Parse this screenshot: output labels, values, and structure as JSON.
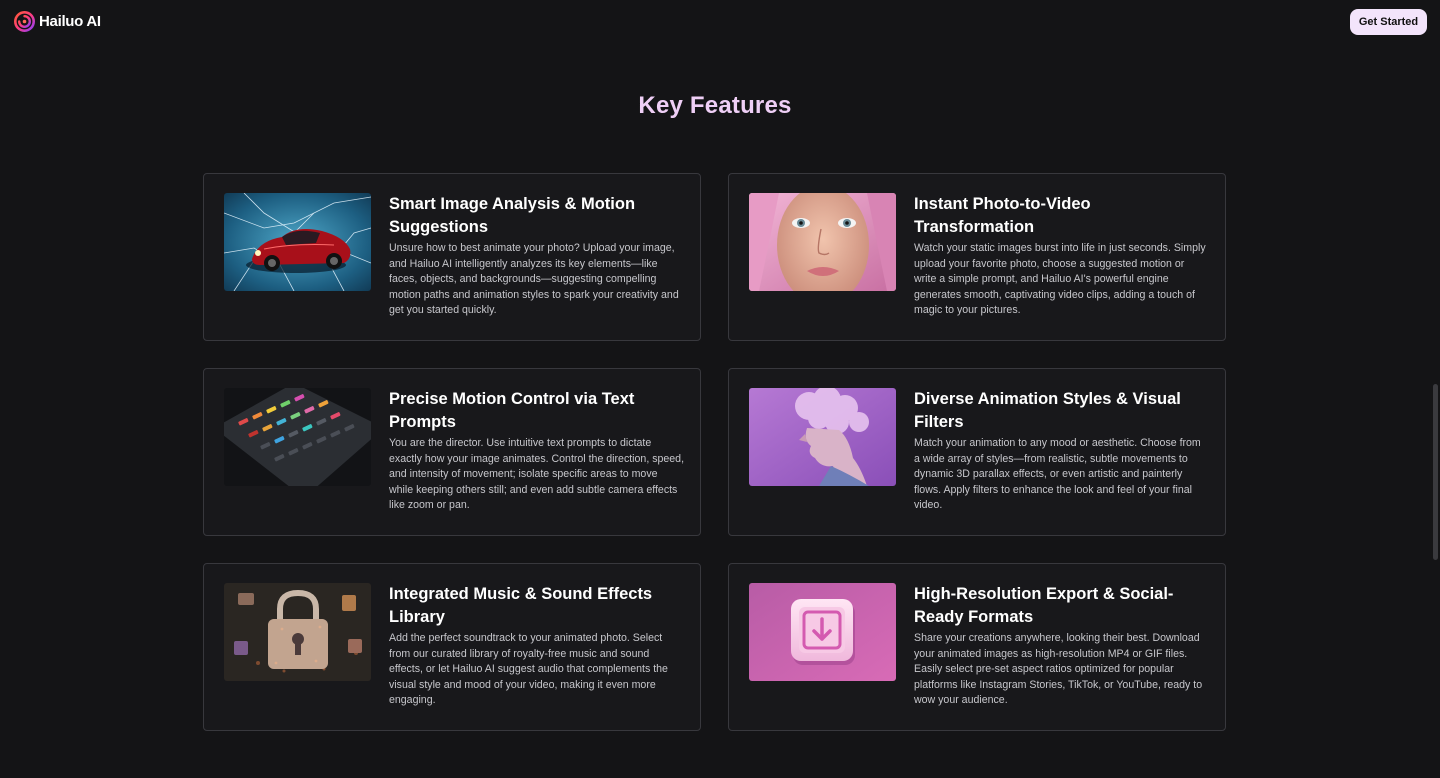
{
  "header": {
    "logo_text": "Hailuo AI",
    "cta_label": "Get Started"
  },
  "section": {
    "title": "Key Features"
  },
  "features": [
    {
      "title": "Smart Image Analysis & Motion Suggestions",
      "description": "Unsure how to best animate your photo? Upload your image, and Hailuo AI intelligently analyzes its key elements—like faces, objects, and backgrounds—suggesting compelling motion paths and animation styles to spark your creativity and get you started quickly."
    },
    {
      "title": "Instant Photo-to-Video Transformation",
      "description": "Watch your static images burst into life in just seconds. Simply upload your favorite photo, choose a suggested motion or write a simple prompt, and Hailuo AI's powerful engine generates smooth, captivating video clips, adding a touch of magic to your pictures."
    },
    {
      "title": "Precise Motion Control via Text Prompts",
      "description": "You are the director. Use intuitive text prompts to dictate exactly how your image animates. Control the direction, speed, and intensity of movement; isolate specific areas to move while keeping others still; and even add subtle camera effects like zoom or pan."
    },
    {
      "title": "Diverse Animation Styles & Visual Filters",
      "description": "Match your animation to any mood or aesthetic. Choose from a wide array of styles—from realistic, subtle movements to dynamic 3D parallax effects, or even artistic and painterly flows. Apply filters to enhance the look and feel of your final video."
    },
    {
      "title": "Integrated Music & Sound Effects Library",
      "description": "Add the perfect soundtrack to your animated photo. Select from our curated library of royalty-free music and sound effects, or let Hailuo AI suggest audio that complements the visual style and mood of your video, making it even more engaging."
    },
    {
      "title": "High-Resolution Export & Social-Ready Formats",
      "description": "Share your creations anywhere, looking their best. Download your animated images as high-resolution MP4 or GIF files. Easily select pre-set aspect ratios optimized for popular platforms like Instagram Stories, TikTok, or YouTube, ready to wow your audience."
    }
  ],
  "colors": {
    "background": "#141416",
    "title_accent": "#efcff6",
    "cta_background": "#f3e4fb",
    "card_border": "#38383d"
  },
  "icons": {
    "logo": "hailuo-swirl-logo-icon",
    "export_thumb": "download-arrow-icon"
  }
}
